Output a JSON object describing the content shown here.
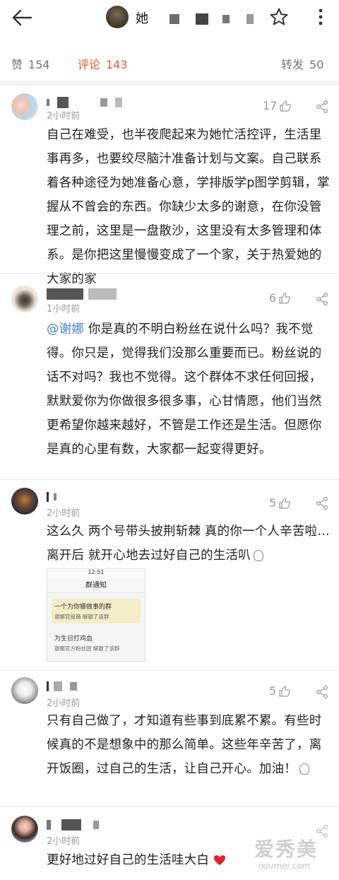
{
  "header": {
    "title_prefix": "她",
    "back_icon": "arrow-left-icon",
    "star_icon": "star-outline-icon",
    "more_icon": "more-vertical-icon"
  },
  "stats": {
    "likes_label": "赞",
    "likes_count": "154",
    "comments_label": "评论",
    "comments_count": "143",
    "reposts_label": "转发",
    "reposts_count": "50",
    "active_color": "#e0572a"
  },
  "comments": [
    {
      "time": "2小时前",
      "likes": "17",
      "text": "自己在难受，也半夜爬起来为她忙活控评，生活里事再多，也要绞尽脑汁准备计划与文案。自己联系着各种途径为她准备心意，学排版学p图学剪辑，掌握从不曾会的东西。你缺少太多的谢意，在你没管理之前，这里是一盘散沙，这里没有太多管理和体系。是你把这里慢慢变成了一个家，关于热爱她的大家的家"
    },
    {
      "time": "1小时前",
      "likes": "6",
      "mention": "@谢娜",
      "text": " 你是真的不明白粉丝在说什么吗？我不觉得。你只是，觉得我们没那么重要而已。粉丝说的话不对吗？我也不觉得。这个群体不求任何回报，默默爱你为你做很多很多事，心甘情愿，他们当然更希望你越来越好，不管是工作还是生活。但愿你是真的心里有数，大家都一起变得更好。"
    },
    {
      "time": "2小时前",
      "likes": "5",
      "text": "这么久 两个号带头披荆斩棘 真的你一个人辛苦啦…离开后 就开心地去过好自己的生活叭",
      "screenshot": {
        "status_time": "12:51",
        "title": "群通知",
        "notice1_title": "一个为你娜做事的群",
        "notice1_sub": "谢娜官投箱 解散了该群",
        "notice2_title": "为生日打鸡血",
        "notice2_sub": "谢娜官方粉丝团 解散了该群"
      }
    },
    {
      "time": "2小时前",
      "likes": "5",
      "text": "只有自己做了，才知道有些事到底累不累。有些时候真的不是想象中的那么简单。这些年辛苦了，离开饭圈，过自己的生活，让自己开心。加油！"
    },
    {
      "time": "2小时前",
      "text": "更好地过好自己的生活哇大白"
    }
  ],
  "watermark": {
    "main": "爱秀美",
    "sub": "ixiumei.com"
  }
}
